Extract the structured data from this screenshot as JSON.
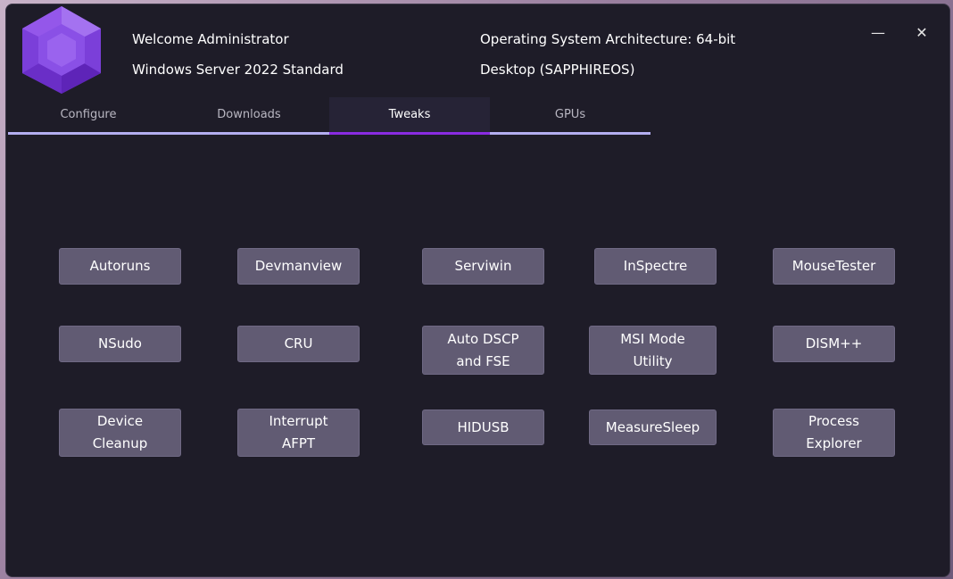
{
  "header": {
    "welcome": "Welcome Administrator",
    "os_name": "Windows Server 2022 Standard",
    "architecture": "Operating System Architecture: 64-bit",
    "device": "Desktop (SAPPHIREOS)"
  },
  "window_controls": {
    "minimize": "—",
    "close": "✕"
  },
  "tabs": [
    {
      "label": "Configure"
    },
    {
      "label": "Downloads"
    },
    {
      "label": "Tweaks"
    },
    {
      "label": "GPUs"
    }
  ],
  "tools": {
    "autoruns": "Autoruns",
    "devmanview": "Devmanview",
    "serviwin": "Serviwin",
    "inspectre": "InSpectre",
    "mousetester": "MouseTester",
    "nsudo": "NSudo",
    "cru": "CRU",
    "auto_dscp": "Auto DSCP\nand FSE",
    "msi_mode": "MSI Mode\nUtility",
    "dism": "DISM++",
    "device_cleanup": "Device\nCleanup",
    "interrupt_afpt": "Interrupt\nAFPT",
    "hidusb": "HIDUSB",
    "measuresleep": "MeasureSleep",
    "process_explorer": "Process\nExplorer"
  },
  "colors": {
    "accent": "#8a2be2",
    "tab_underline": "#b3aef0",
    "button_bg": "#615b73",
    "window_bg": "#1e1c28"
  }
}
